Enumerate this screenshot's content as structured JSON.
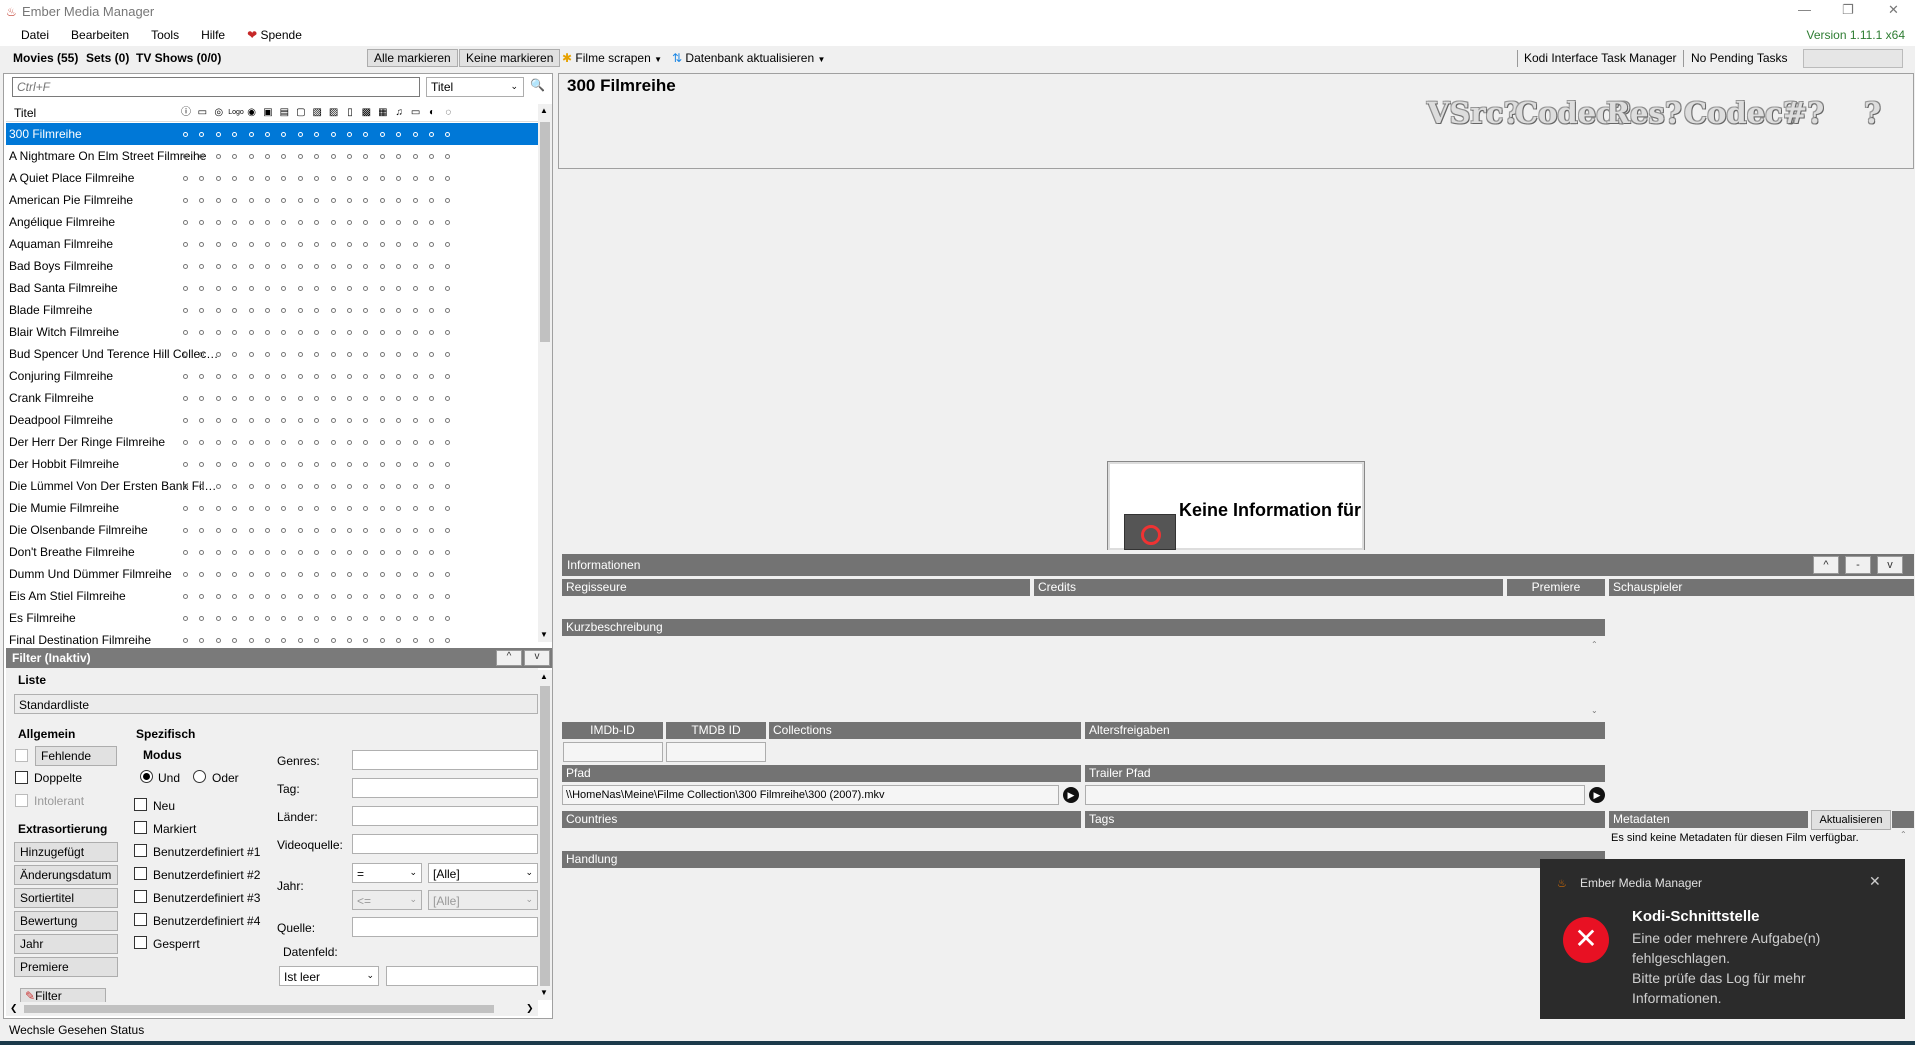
{
  "window": {
    "title": "Ember Media Manager",
    "version": "Version 1.11.1 x64"
  },
  "menu": [
    "Datei",
    "Bearbeiten",
    "Tools",
    "Hilfe",
    "Spende"
  ],
  "toolbar": {
    "tabs": [
      "Movies (55)",
      "Sets (0)",
      "TV Shows (0/0)"
    ],
    "alle_markieren": "Alle markieren",
    "keine_markieren": "Keine markieren",
    "filme_scrapen": "Filme scrapen",
    "datenbank": "Datenbank aktualisieren",
    "kodi": "Kodi Interface Task Manager",
    "pending": "No Pending Tasks"
  },
  "search": {
    "placeholder": "Ctrl+F",
    "sort_value": "Titel"
  },
  "list": {
    "header": "Titel",
    "header_icons": [
      "info-icon",
      "banner-icon",
      "clearart-icon",
      "clearlogo-icon",
      "discart-icon",
      "extrafanart-icon",
      "extrathumbs-icon",
      "fanart-icon",
      "keyart-icon",
      "landscape-icon",
      "nfo-icon",
      "poster-icon",
      "subtitle-icon",
      "theme-icon",
      "trailer-icon",
      "watched-icon",
      "mark-icon"
    ],
    "items": [
      "300 Filmreihe",
      "A Nightmare On Elm Street Filmreihe",
      "A Quiet Place Filmreihe",
      "American Pie Filmreihe",
      "Angélique Filmreihe",
      "Aquaman Filmreihe",
      "Bad Boys Filmreihe",
      "Bad Santa Filmreihe",
      "Blade Filmreihe",
      "Blair Witch Filmreihe",
      "Bud Spencer Und Terence Hill Collecti...",
      "Conjuring Filmreihe",
      "Crank Filmreihe",
      "Deadpool Filmreihe",
      "Der Herr Der Ringe Filmreihe",
      "Der Hobbit Filmreihe",
      "Die Lümmel Von Der Ersten Bank Filmr...",
      "Die Mumie Filmreihe",
      "Die Olsenbande Filmreihe",
      "Don't Breathe Filmreihe",
      "Dumm Und Dümmer Filmreihe",
      "Eis Am Stiel Filmreihe",
      "Es Filmreihe",
      "Final Destination Filmreihe"
    ],
    "selected": 0
  },
  "filter": {
    "header": "Filter (Inaktiv)",
    "liste_label": "Liste",
    "liste_value": "Standardliste",
    "allgemein": "Allgemein",
    "fehlende": "Fehlende",
    "doppelte": "Doppelte",
    "intolerant": "Intolerant",
    "extrasortierung": "Extrasortierung",
    "sort_buttons": [
      "Hinzugefügt",
      "Änderungsdatum",
      "Sortiertitel",
      "Bewertung",
      "Jahr",
      "Premiere"
    ],
    "filter_loeschen": "Filter löschen",
    "spezifisch": "Spezifisch",
    "modus": "Modus",
    "und": "Und",
    "oder": "Oder",
    "checks": [
      "Neu",
      "Markiert",
      "Benutzerdefiniert #1",
      "Benutzerdefiniert #2",
      "Benutzerdefiniert #3",
      "Benutzerdefiniert #4",
      "Gesperrt"
    ],
    "genres": "Genres:",
    "tag": "Tag:",
    "laender": "Länder:",
    "videoquelle": "Videoquelle:",
    "jahr": "Jahr:",
    "jahr_op1": "=",
    "jahr_val1": "[Alle]",
    "jahr_op2": "<=",
    "jahr_val2": "[Alle]",
    "quelle": "Quelle:",
    "datenfeld": "Datenfeld:",
    "datenfeld_value": "Ist leer"
  },
  "status": "Wechsle Gesehen Status",
  "detail": {
    "title": "300 Filmreihe",
    "flags": [
      "VSrc?",
      "Codec?",
      "Res?",
      "Codec?",
      "#?",
      "?"
    ],
    "poster_text": "Keine Information für",
    "informationen": "Informationen",
    "regisseure": "Regisseure",
    "credits": "Credits",
    "premiere": "Premiere",
    "schauspieler": "Schauspieler",
    "kurzbeschreibung": "Kurzbeschreibung",
    "imdb": "IMDb-ID",
    "tmdb": "TMDB ID",
    "collections": "Collections",
    "altersfreigaben": "Altersfreigaben",
    "pfad": "Pfad",
    "pfad_value": "\\\\HomeNas\\Meine\\Filme Collection\\300 Filmreihe\\300 (2007).mkv",
    "trailer_pfad": "Trailer Pfad",
    "countries": "Countries",
    "tags": "Tags",
    "metadaten": "Metadaten",
    "aktualisieren": "Aktualisieren",
    "meta_text": "Es sind keine Metadaten für diesen Film verfügbar.",
    "handlung": "Handlung"
  },
  "toast": {
    "app": "Ember Media Manager",
    "title": "Kodi-Schnittstelle",
    "lines": [
      "Eine oder mehrere Aufgabe(n)",
      "fehlgeschlagen.",
      "Bitte prüfe das Log für mehr",
      "Informationen."
    ]
  }
}
